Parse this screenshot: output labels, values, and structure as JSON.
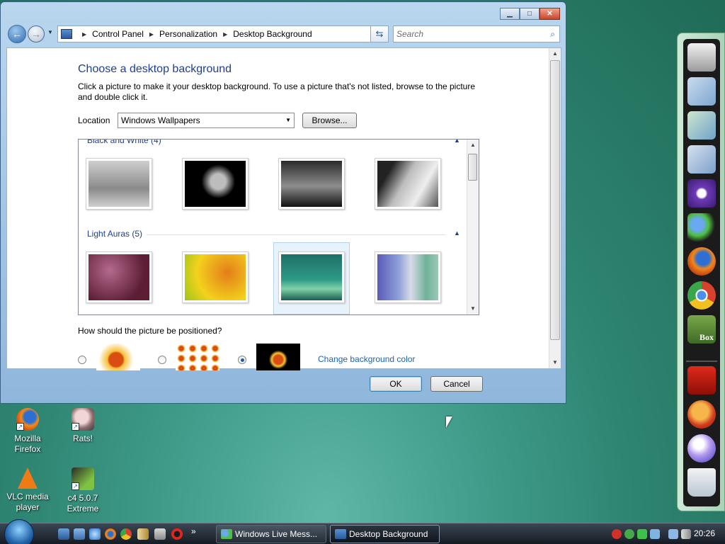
{
  "address_bar": {
    "crumbs": [
      "Control Panel",
      "Personalization",
      "Desktop Background"
    ],
    "search_placeholder": "Search"
  },
  "main": {
    "heading": "Choose a desktop background",
    "description": "Click a picture to make it your desktop background. To use a picture that's not listed, browse to the picture and double click it.",
    "location_label": "Location",
    "location_value": "Windows Wallpapers",
    "browse_label": "Browse...",
    "groups": [
      {
        "name": "Black and White (4)"
      },
      {
        "name": "Light Auras (5)"
      }
    ],
    "position_question": "How should the picture be positioned?",
    "change_color_link": "Change background color",
    "ok_label": "OK",
    "cancel_label": "Cancel"
  },
  "desktop_icons": [
    {
      "label": "Mozilla Firefox"
    },
    {
      "label": "Rats!"
    },
    {
      "label": "VLC media player"
    },
    {
      "label": "c4 5.0.7 Extreme"
    }
  ],
  "taskbar": {
    "quick_more": "»",
    "buttons": [
      {
        "label": "Windows Live Mess..."
      },
      {
        "label": "Desktop Background"
      }
    ],
    "clock": "20:26"
  },
  "dock_labels": {
    "box": "Box"
  },
  "colors": {
    "link": "#1b64b3",
    "heading": "#1e3f8f"
  }
}
